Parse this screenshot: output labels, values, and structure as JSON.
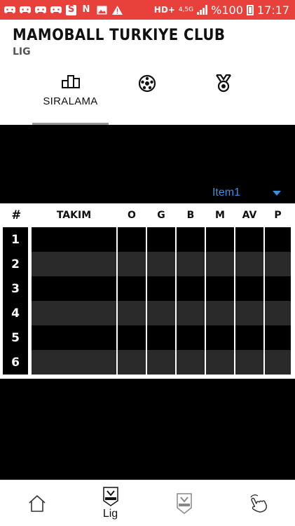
{
  "status_bar": {
    "network": "HD+",
    "network_type": "4,5G",
    "battery": "%100",
    "time": "17:17",
    "notification_icons": [
      "gamepad-icon",
      "gamepad-icon",
      "gamepad-icon",
      "gamepad-icon",
      "s-app-icon",
      "n-app-icon",
      "image-icon",
      "warning-icon"
    ]
  },
  "header": {
    "title": "MAMOBALL TURKIYE CLUB",
    "subtitle": "LIG"
  },
  "tabs": [
    {
      "icon": "podium-icon",
      "label": "SIRALAMA",
      "active": true
    },
    {
      "icon": "soccer-ball-icon",
      "label": "",
      "active": false
    },
    {
      "icon": "medal-icon",
      "label": "",
      "active": false
    }
  ],
  "dropdown": {
    "value": "Item1"
  },
  "table": {
    "headers": [
      "#",
      "TAKIM",
      "O",
      "G",
      "B",
      "M",
      "AV",
      "P"
    ],
    "rows": [
      {
        "rank": "1"
      },
      {
        "rank": "2"
      },
      {
        "rank": "3"
      },
      {
        "rank": "4"
      },
      {
        "rank": "5"
      },
      {
        "rank": "6"
      }
    ]
  },
  "bottom_nav": [
    {
      "icon": "home-icon",
      "label": ""
    },
    {
      "icon": "league-badge-icon",
      "label": "Lig"
    },
    {
      "icon": "cup-badge-icon",
      "label": ""
    },
    {
      "icon": "tap-hand-icon",
      "label": ""
    }
  ],
  "colors": {
    "status_bar": "#e8413c",
    "accent": "#3b8fe0",
    "row_alt": "#2a2a2a"
  }
}
